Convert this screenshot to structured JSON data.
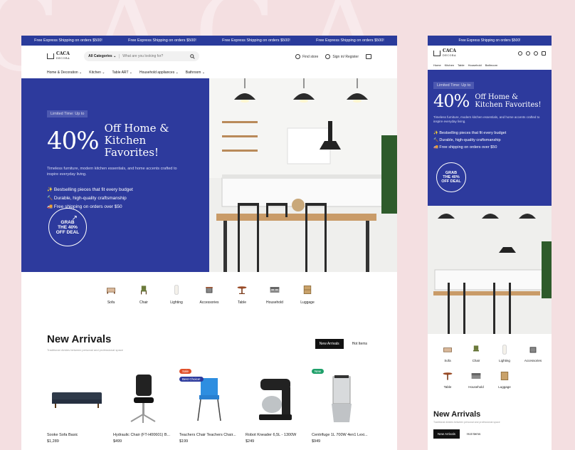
{
  "ticker": {
    "text": "Free Express Shipping on orders $500!"
  },
  "brand": {
    "name": "CACA",
    "sub": "DECORA"
  },
  "search": {
    "category": "All Categories",
    "placeholder": "What are you looking for?"
  },
  "header": {
    "find_store": "Find store",
    "sign_in": "Sign in/ Register"
  },
  "nav": [
    "Home & Decoration",
    "Kitchen",
    "Table ART",
    "Household appliances",
    "Bathroom"
  ],
  "mobile_nav": [
    "Home",
    "Kitchen",
    "Table",
    "Household",
    "Bathroom"
  ],
  "hero": {
    "pill": "Limited Time: Up to",
    "percent": "40%",
    "headline_1": "Off Home &",
    "headline_2": "Kitchen Favorites!",
    "description": "Timeless furniture, modern kitchen essentials, and home accents crafted to inspire everyday living.",
    "bullets": [
      "✨ Bestselling pieces that fit every budget",
      "🔨 Durable, high-quality craftsmanship",
      "🚚 Free shipping on orders over $50"
    ],
    "grab_1": "GRAB",
    "grab_2": "THE 40%",
    "grab_3": "OFF DEAL"
  },
  "categories": [
    "Sofa",
    "Chair",
    "Lighting",
    "Accessories",
    "Table",
    "Household",
    "Luggage"
  ],
  "arrivals": {
    "title": "New Arrivals",
    "subtitle": "Traditional divides between personal and professional space",
    "tab_new": "New Arrivals",
    "tab_hot": "Hot Items"
  },
  "products": [
    {
      "name": "Sooke Sofa Basic",
      "price": "$1,289",
      "badge": ""
    },
    {
      "name": "Hydraulic Chair (FT-H00601) B...",
      "price": "$499",
      "badge": ""
    },
    {
      "name": "Teachers Chair Teachers Chair...",
      "price": "$199",
      "badge": "Sale",
      "badge2": "Best Choice!"
    },
    {
      "name": "Robot Kneader 6,5L - 1300W",
      "price": "$249",
      "badge": ""
    },
    {
      "name": "Centrifuge 1L 700W 4en1 Lexi...",
      "price": "$949",
      "badge": "New"
    }
  ],
  "colors": {
    "primary": "#2d3a9d",
    "background": "#f4dfe1",
    "sale": "#e0502a",
    "new": "#1fa06a"
  }
}
